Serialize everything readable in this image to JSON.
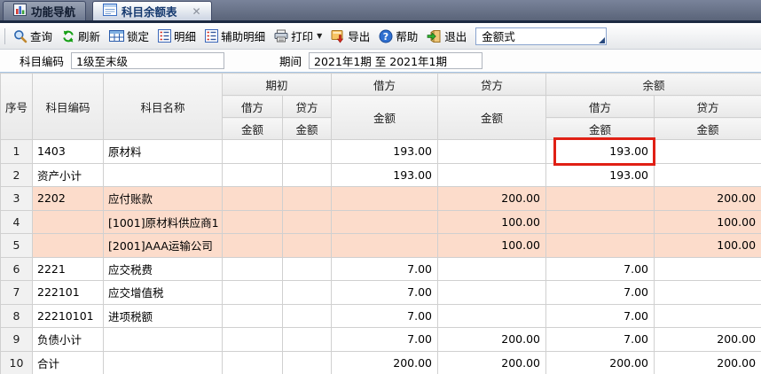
{
  "tabs": [
    {
      "label": "功能导航",
      "active": false
    },
    {
      "label": "科目余额表",
      "active": true,
      "close_glyph": "✕"
    }
  ],
  "toolbar": {
    "buttons": [
      {
        "label": "查询",
        "icon": "search-icon"
      },
      {
        "label": "刷新",
        "icon": "refresh-icon"
      },
      {
        "label": "锁定",
        "icon": "lock-grid-icon"
      },
      {
        "label": "明细",
        "icon": "detail-list-icon"
      },
      {
        "label": "辅助明细",
        "icon": "aux-detail-list-icon"
      },
      {
        "label": "打印",
        "icon": "printer-icon",
        "caret": "▼"
      },
      {
        "label": "导出",
        "icon": "export-icon"
      },
      {
        "label": "帮助",
        "icon": "help-icon"
      },
      {
        "label": "退出",
        "icon": "exit-icon"
      }
    ],
    "view_mode": "金额式"
  },
  "filters": {
    "code_label": "科目编码",
    "code_value": "1级至末级",
    "period_label": "期间",
    "period_value": "2021年1期  至  2021年1期"
  },
  "table": {
    "headers": {
      "seq": "序号",
      "code": "科目编码",
      "name": "科目名称",
      "opening": "期初",
      "debit": "借方",
      "credit": "贷方",
      "balance": "余额",
      "amount": "金额"
    },
    "rows": [
      {
        "seq": "1",
        "code": "1403",
        "name": "原材料",
        "ob_d": "",
        "ob_c": "",
        "d": "193.00",
        "c": "",
        "bd": "193.00",
        "bc": ""
      },
      {
        "seq": "2",
        "code": "资产小计",
        "name": "",
        "ob_d": "",
        "ob_c": "",
        "d": "193.00",
        "c": "",
        "bd": "193.00",
        "bc": ""
      },
      {
        "seq": "3",
        "code": "2202",
        "name": "应付账款",
        "ob_d": "",
        "ob_c": "",
        "d": "",
        "c": "200.00",
        "bd": "",
        "bc": "200.00"
      },
      {
        "seq": "4",
        "code": "",
        "name": "[1001]原材料供应商1",
        "ob_d": "",
        "ob_c": "",
        "d": "",
        "c": "100.00",
        "bd": "",
        "bc": "100.00"
      },
      {
        "seq": "5",
        "code": "",
        "name": "[2001]AAA运输公司",
        "ob_d": "",
        "ob_c": "",
        "d": "",
        "c": "100.00",
        "bd": "",
        "bc": "100.00"
      },
      {
        "seq": "6",
        "code": "2221",
        "name": "应交税费",
        "ob_d": "",
        "ob_c": "",
        "d": "7.00",
        "c": "",
        "bd": "7.00",
        "bc": ""
      },
      {
        "seq": "7",
        "code": "222101",
        "name": "应交增值税",
        "ob_d": "",
        "ob_c": "",
        "d": "7.00",
        "c": "",
        "bd": "7.00",
        "bc": ""
      },
      {
        "seq": "8",
        "code": "22210101",
        "name": "进项税额",
        "ob_d": "",
        "ob_c": "",
        "d": "7.00",
        "c": "",
        "bd": "7.00",
        "bc": ""
      },
      {
        "seq": "9",
        "code": "负债小计",
        "name": "",
        "ob_d": "",
        "ob_c": "",
        "d": "7.00",
        "c": "200.00",
        "bd": "7.00",
        "bc": "200.00"
      },
      {
        "seq": "10",
        "code": "合计",
        "name": "",
        "ob_d": "",
        "ob_c": "",
        "d": "200.00",
        "c": "200.00",
        "bd": "200.00",
        "bc": "200.00"
      }
    ],
    "highlight": {
      "row": 1,
      "column": "balance-debit-amount",
      "value": "193.00"
    }
  },
  "colors": {
    "highlight_border": "#e02015",
    "row_pink": "#fcdccb",
    "tabbar_bg": "#67718a",
    "header_bg": "#f1f1f1"
  }
}
